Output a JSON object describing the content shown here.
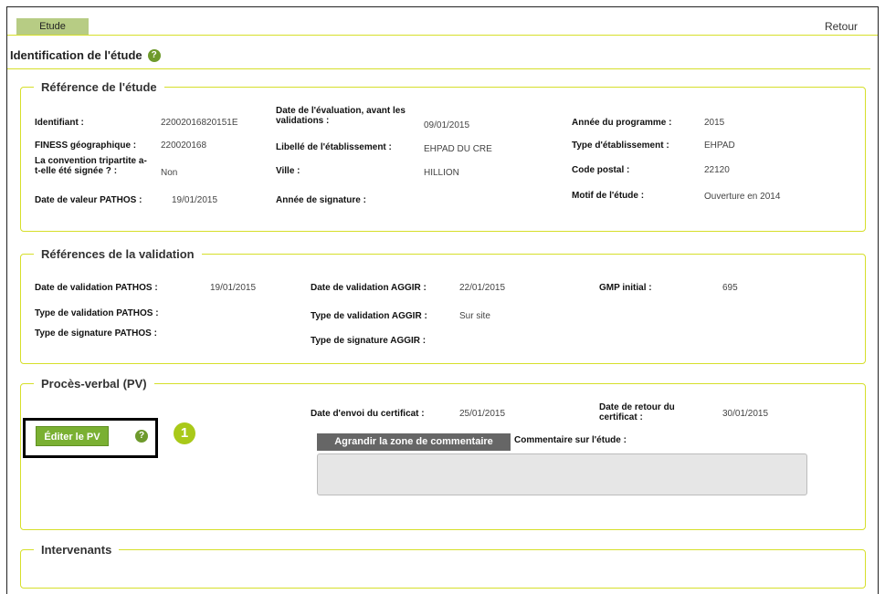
{
  "tab": {
    "label": "Etude"
  },
  "retour": "Retour",
  "identification_title": "Identification de l'étude",
  "help_glyph": "?",
  "sections": {
    "reference": {
      "title": "Référence de l'étude",
      "fields": {
        "identifiant": {
          "label": "Identifiant :",
          "value": "22002016820151E"
        },
        "date_evaluation": {
          "label": "Date de l'évaluation, avant les validations :",
          "value": "09/01/2015"
        },
        "annee_programme": {
          "label": "Année du programme :",
          "value": "2015"
        },
        "finess": {
          "label": "FINESS géographique :",
          "value": "220020168"
        },
        "libelle": {
          "label": "Libellé de l'établissement :",
          "value": "EHPAD DU CRE"
        },
        "type_etab": {
          "label": "Type d'établissement :",
          "value": "EHPAD"
        },
        "convention": {
          "label": "La convention tripartite a-t-elle été signée ? :",
          "value": "Non"
        },
        "ville": {
          "label": "Ville :",
          "value": "HILLION"
        },
        "code_postal": {
          "label": "Code postal :",
          "value": "22120"
        },
        "motif": {
          "label": "Motif de l'étude :",
          "value": "Ouverture en 2014"
        },
        "date_valeur": {
          "label": "Date de valeur PATHOS :",
          "value": "19/01/2015"
        },
        "annee_signature": {
          "label": "Année de signature :",
          "value": ""
        }
      }
    },
    "validation": {
      "title": "Références de la validation",
      "fields": {
        "date_val_pathos": {
          "label": "Date de validation PATHOS :",
          "value": "19/01/2015"
        },
        "date_val_aggir": {
          "label": "Date de validation AGGIR :",
          "value": "22/01/2015"
        },
        "gmp": {
          "label": "GMP initial :",
          "value": "695"
        },
        "type_val_pathos": {
          "label": "Type de validation PATHOS :",
          "value": ""
        },
        "type_val_aggir": {
          "label": "Type de validation AGGIR :",
          "value": "Sur site"
        },
        "type_sig_pathos": {
          "label": "Type de signature PATHOS :",
          "value": ""
        },
        "type_sig_aggir": {
          "label": "Type de signature AGGIR :",
          "value": ""
        }
      }
    },
    "pv": {
      "title": "Procès-verbal (PV)",
      "edit_button": "Éditer le PV",
      "callout": "1",
      "date_envoi": {
        "label": "Date d'envoi du certificat :",
        "value": "25/01/2015"
      },
      "date_retour": {
        "label": "Date de retour du certificat :",
        "value": "30/01/2015"
      },
      "agrandir_button": "Agrandir la zone de commentaire",
      "comment_label": "Commentaire sur l'étude :",
      "comment_value": ""
    },
    "intervenants": {
      "title": "Intervenants"
    }
  },
  "colors": {
    "accent_line": "#d6df2a",
    "tab_bg": "#b7cc84",
    "button_green": "#7ab032",
    "callout": "#a9c919"
  }
}
